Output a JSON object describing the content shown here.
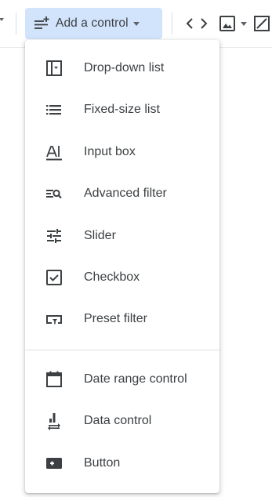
{
  "toolbar": {
    "add_control_label": "Add a control",
    "colors": {
      "button_bg": "#d2e3fc",
      "icon": "#5f6368",
      "text": "#3c4043"
    }
  },
  "menu": {
    "items": [
      {
        "label": "Drop-down list",
        "icon": "dropdown-list-icon"
      },
      {
        "label": "Fixed-size list",
        "icon": "fixed-size-list-icon"
      },
      {
        "label": "Input box",
        "icon": "input-box-icon"
      },
      {
        "label": "Advanced filter",
        "icon": "advanced-filter-icon"
      },
      {
        "label": "Slider",
        "icon": "slider-icon"
      },
      {
        "label": "Checkbox",
        "icon": "checkbox-icon"
      },
      {
        "label": "Preset filter",
        "icon": "preset-filter-icon"
      },
      {
        "label": "Date range control",
        "icon": "calendar-icon"
      },
      {
        "label": "Data control",
        "icon": "data-control-icon"
      },
      {
        "label": "Button",
        "icon": "button-icon"
      }
    ]
  }
}
